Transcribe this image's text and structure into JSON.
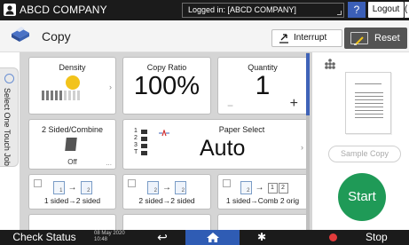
{
  "topbar": {
    "company": "ABCD COMPANY",
    "login_text": "Logged in: [ABCD COMPANY]",
    "help_label": "?",
    "logout_label": "Logout",
    "clipped_label": "(",
    "icon": "user-icon"
  },
  "titlebar": {
    "title": "Copy",
    "interrupt_label": "Interrupt",
    "reset_label": "Reset"
  },
  "side_tab": {
    "label": "Select One Touch Job"
  },
  "tiles": {
    "density": {
      "label": "Density",
      "level": 5,
      "levels": 9
    },
    "ratio": {
      "label": "Copy Ratio",
      "value": "100%"
    },
    "quantity": {
      "label": "Quantity",
      "value": "1",
      "minus": "−",
      "plus": "+"
    },
    "sided": {
      "label": "2 Sided/Combine",
      "status": "Off",
      "more": "..."
    },
    "paper": {
      "label": "Paper Select",
      "value": "Auto",
      "trays": [
        "1",
        "2",
        "3",
        "T"
      ]
    }
  },
  "presets": [
    {
      "label": "1 sided→2 sided"
    },
    {
      "label": "2 sided→2 sided"
    },
    {
      "label": "1 sided→Comb 2 orig",
      "boxes": [
        "1",
        "2"
      ]
    }
  ],
  "right": {
    "sample_label": "Sample Copy",
    "start_label": "Start"
  },
  "bottombar": {
    "status_label": "Check Status",
    "date": "08 May 2020",
    "time": "10:48",
    "stop_label": "Stop"
  },
  "colors": {
    "start": "#1f9a57",
    "home": "#2f5cb4",
    "accent_blue": "#3b5fb7",
    "density_sun": "#f2c31b",
    "stop": "#e23b3b"
  }
}
